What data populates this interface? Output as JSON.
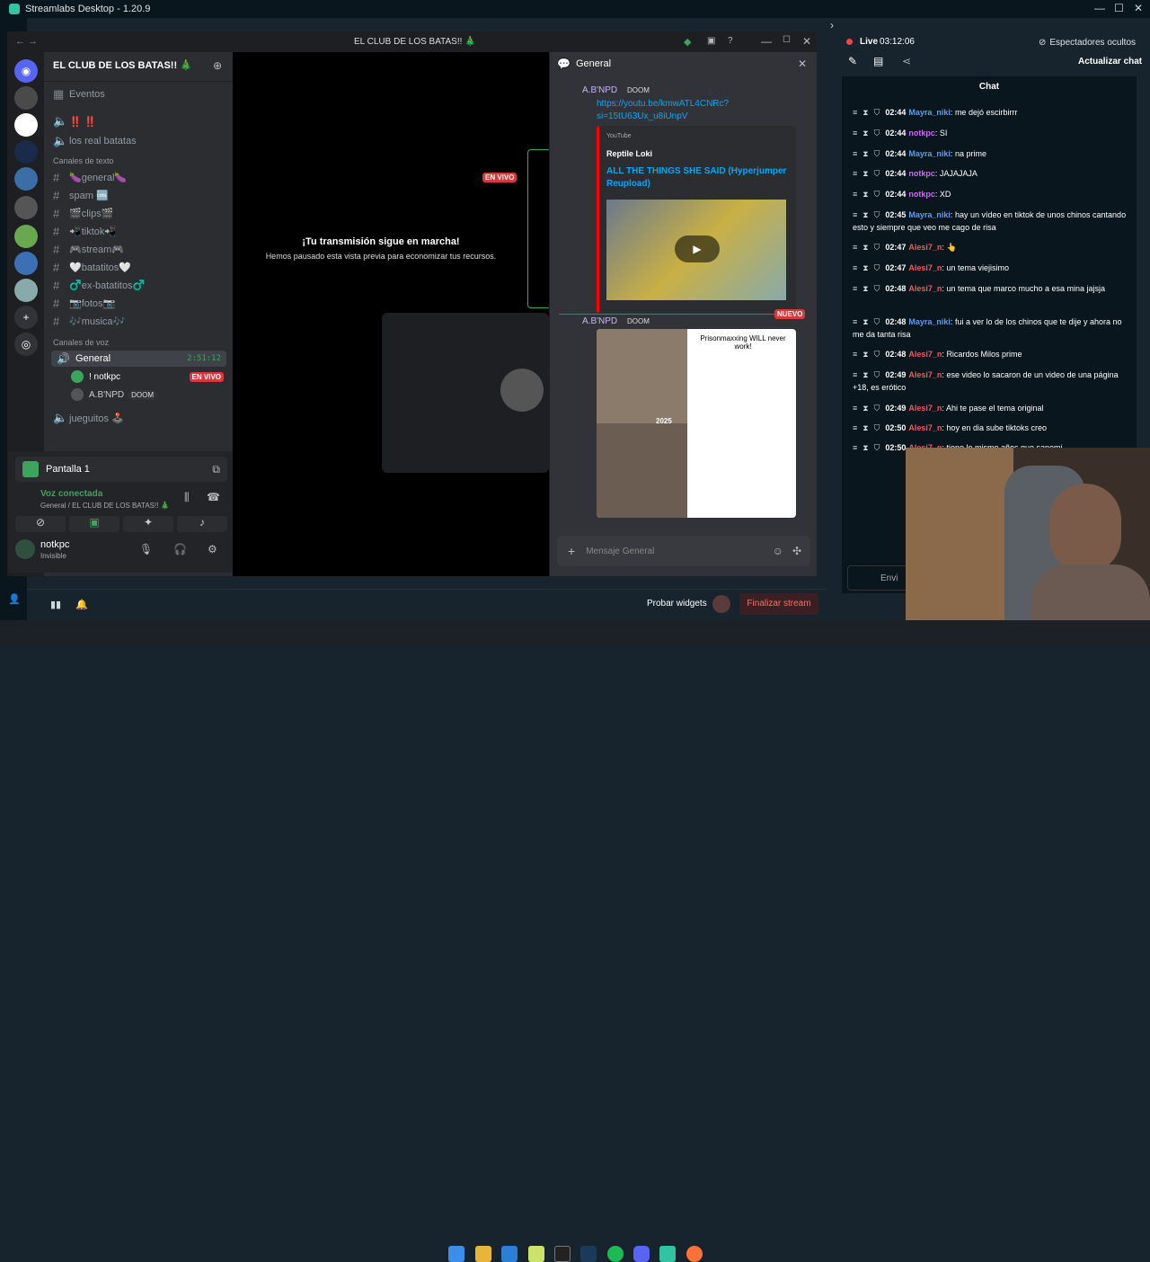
{
  "app": {
    "title": "Streamlabs Desktop - 1.20.9"
  },
  "discord": {
    "window_title": "EL CLUB DE LOS BATAS!! 🎄",
    "server_name": "EL CLUB DE LOS BATAS!! 🎄",
    "events_label": "Eventos",
    "top_channels": [
      "‼️ ‼️",
      "los real batatas"
    ],
    "text_category": "Canales de texto",
    "text_channels": [
      "🍆general🍆",
      "spam 🆒",
      "🎬clips🎬",
      "📲tiktok📲",
      "🎮stream🎮",
      "🤍batatitos🤍",
      "♂️ex-batatitos♂️",
      "📷fotos📷",
      "🎶musica🎶"
    ],
    "voice_category": "Canales de voz",
    "voice_channel": "General",
    "voice_timer": "2:51:12",
    "voice_users": [
      {
        "name": "! notkpc",
        "badge": "EN VIVO"
      },
      {
        "name": "A.B'NPD",
        "badge": "DOOM"
      }
    ],
    "other_voice": "jueguitos 🕹️",
    "screen_label": "Pantalla 1",
    "voice_connected": "Voz conectada",
    "voice_connected_sub": "General / EL CLUB DE LOS BATAS!! 🎄",
    "user_name": "notkpc",
    "user_status": "Invisible",
    "stream_paused_title": "¡Tu transmisión sigue en marcha!",
    "stream_paused_sub": "Hemos pausado esta vista previa para economizar tus recursos.",
    "live_badge": "EN VIVO",
    "chat_title": "General",
    "msg1_author": "A.B'NPD",
    "msg1_tag": "DOOM",
    "msg1_link": "https://youtube.com/shorts/kmwATL4CNRc?si=15tU63Ux_u8iUnpV",
    "msg1_link_l1": "https://youtu.be/kmwATL4CNRc?",
    "msg1_link_l2": "si=15tU63Ux_u8iUnpV",
    "embed_provider": "YouTube",
    "embed_author": "Reptile Loki",
    "embed_title": "ALL THE THINGS SHE SAID (Hyperjumper Reupload)",
    "new_label": "NUEVO",
    "msg2_author": "A.B'NPD",
    "msg2_tag": "DOOM",
    "meme_text": "Prisonmaxxing WILL never work!",
    "meme_year": "2025",
    "input_placeholder": "Mensaje General"
  },
  "streamlabs": {
    "live_label": "Live",
    "live_time": "03:12:06",
    "viewers_label": "Espectadores ocultos",
    "refresh_chat": "Actualizar chat",
    "chat_header": "Chat",
    "chat_input": "Envi",
    "test_widgets": "Probar widgets",
    "end_stream": "Finalizar stream",
    "messages": [
      {
        "time": "02:44",
        "user": "Mayra_niki",
        "color": "#5b9df5",
        "text": "me dejó escirbirrr"
      },
      {
        "time": "02:44",
        "user": "notkpc",
        "color": "#c86aef",
        "text": "SI"
      },
      {
        "time": "02:44",
        "user": "Mayra_niki",
        "color": "#5b9df5",
        "text": "na prime"
      },
      {
        "time": "02:44",
        "user": "notkpc",
        "color": "#c86aef",
        "text": "JAJAJAJA"
      },
      {
        "time": "02:44",
        "user": "notkpc",
        "color": "#c86aef",
        "text": "XD"
      },
      {
        "time": "02:45",
        "user": "Mayra_niki",
        "color": "#5b9df5",
        "text": "hay un vídeo en tiktok de unos chinos cantando esto y siempre que veo me cago de risa"
      },
      {
        "time": "02:47",
        "user": "Alesi7_n",
        "color": "#f05a5a",
        "text": "👆"
      },
      {
        "time": "02:47",
        "user": "Alesi7_n",
        "color": "#f05a5a",
        "text": "un tema viejisimo"
      },
      {
        "time": "02:48",
        "user": "Alesi7_n",
        "color": "#f05a5a",
        "text": "un tema que marco mucho a esa mina jajsja"
      },
      {
        "time": "02:48",
        "user": "Mayra_niki",
        "color": "#5b9df5",
        "text": "fui a ver lo de los chinos que te dije y ahora no me da tanta risa"
      },
      {
        "time": "02:48",
        "user": "Alesi7_n",
        "color": "#f05a5a",
        "text": "Ricardos Milos prime"
      },
      {
        "time": "02:49",
        "user": "Alesi7_n",
        "color": "#f05a5a",
        "text": "ese video lo sacaron de un video de una página +18, es erótico"
      },
      {
        "time": "02:49",
        "user": "Alesi7_n",
        "color": "#f05a5a",
        "text": "Ahi te pase el tema original"
      },
      {
        "time": "02:50",
        "user": "Alesi7_n",
        "color": "#f05a5a",
        "text": "hoy en dia sube tiktoks creo"
      },
      {
        "time": "02:50",
        "user": "Alesi7_n",
        "color": "#f05a5a",
        "text": "tiene lo mismo años que sanemi"
      }
    ]
  }
}
